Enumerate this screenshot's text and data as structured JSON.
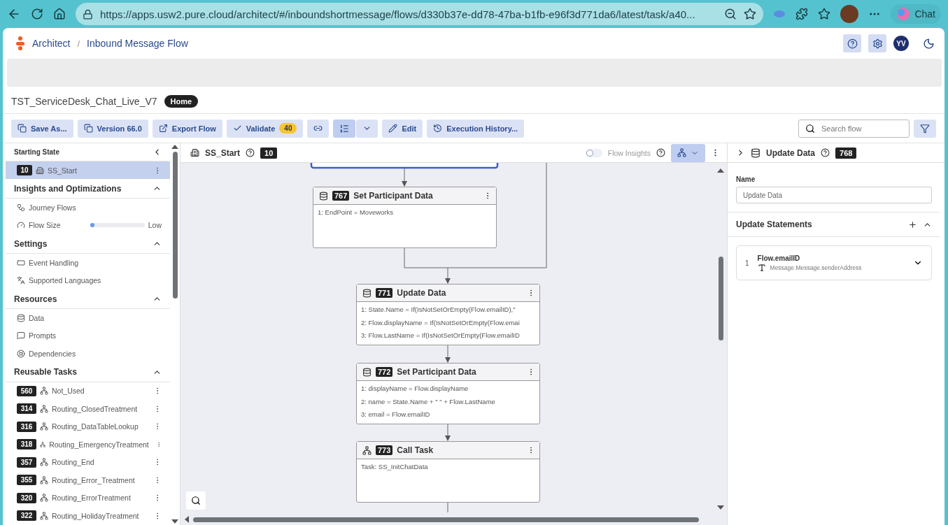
{
  "browser": {
    "url": "https://apps.usw2.pure.cloud/architect/#/inboundshortmessage/flows/d330b37e-dd78-47ba-b1fb-e96f3d771da6/latest/task/a40...",
    "chat_label": "Chat"
  },
  "header": {
    "breadcrumb": [
      "Architect",
      "Inbound Message Flow"
    ],
    "separator": "/",
    "avatar_initials": "YV"
  },
  "flow": {
    "name": "TST_ServiceDesk_Chat_Live_V7",
    "badge": "Home"
  },
  "toolbar": [
    {
      "kind": "copy",
      "label": "Save As..."
    },
    {
      "kind": "copy",
      "label": "Version 66.0"
    },
    {
      "kind": "export",
      "label": "Export Flow"
    },
    {
      "kind": "validate",
      "label": "Validate",
      "count": "40"
    },
    {
      "kind": "link"
    },
    {
      "kind": "list"
    },
    {
      "kind": "edit",
      "label": "Edit"
    },
    {
      "kind": "history",
      "label": "Execution History..."
    }
  ],
  "search": {
    "placeholder": "Search flow"
  },
  "sidebar": {
    "starting_state": {
      "title": "Starting State",
      "number": "10",
      "label": "SS_Start",
      "selected": true
    },
    "sections": [
      {
        "title": "Insights and Optimizations",
        "expanded": true,
        "items": [
          {
            "kind": "journey",
            "label": "Journey Flows"
          },
          {
            "kind": "meter",
            "label": "Flow Size",
            "level": 0.08,
            "reading": "Low"
          }
        ]
      },
      {
        "title": "Settings",
        "expanded": true,
        "items": [
          {
            "kind": "events",
            "label": "Event Handling"
          },
          {
            "kind": "languages",
            "label": "Supported Languages"
          }
        ]
      },
      {
        "title": "Resources",
        "expanded": true,
        "items": [
          {
            "kind": "data",
            "label": "Data"
          },
          {
            "kind": "prompts",
            "label": "Prompts"
          },
          {
            "kind": "dependencies",
            "label": "Dependencies"
          }
        ]
      },
      {
        "title": "Reusable Tasks",
        "expanded": true,
        "items": [
          {
            "kind": "task",
            "number": "560",
            "label": "Not_Used"
          },
          {
            "kind": "task",
            "number": "314",
            "label": "Routing_ClosedTreatment"
          },
          {
            "kind": "task",
            "number": "316",
            "label": "Routing_DataTableLookup"
          },
          {
            "kind": "task",
            "number": "318",
            "label": "Routing_EmergencyTreatment"
          },
          {
            "kind": "task",
            "number": "357",
            "label": "Routing_End"
          },
          {
            "kind": "task",
            "number": "355",
            "label": "Routing_Error_Treatment"
          },
          {
            "kind": "task",
            "number": "320",
            "label": "Routing_ErrorTreatment"
          },
          {
            "kind": "task",
            "number": "322",
            "label": "Routing_HolidayTreatment"
          }
        ]
      }
    ]
  },
  "canvas": {
    "title": "SS_Start",
    "number": "10",
    "insights": {
      "label": "Flow Insights",
      "on": false
    },
    "nodes": [
      {
        "kind": "data",
        "number": "767",
        "title": "Set Participant Data",
        "lines": [
          "1: EndPoint = Moveworks"
        ]
      },
      {
        "kind": "data",
        "number": "771",
        "title": "Update Data",
        "lines": [
          "1: State.Name = If(IsNotSetOrEmpty(Flow.emailID),\"",
          "2: Flow.displayName = If(IsNotSetOrEmpty(Flow.emai",
          "3: Flow.LastName = If(IsNotSetOrEmpty(Flow.emailID"
        ]
      },
      {
        "kind": "data",
        "number": "772",
        "title": "Set Participant Data",
        "lines": [
          "1: displayName = Flow.displayName",
          "2: name = State.Name + \" \" + Flow.LastName",
          "3: email = Flow.emailID"
        ]
      },
      {
        "kind": "task",
        "number": "773",
        "title": "Call Task",
        "lines": [
          "Task: SS_InitChatData"
        ]
      }
    ]
  },
  "panel": {
    "title": "Update Data",
    "number": "768",
    "name_label": "Name",
    "name_value": "Update Data",
    "section": "Update Statements",
    "statements": [
      {
        "index": "1",
        "variable": "Flow.emailID",
        "value": "Message.Message.senderAddress"
      }
    ]
  }
}
